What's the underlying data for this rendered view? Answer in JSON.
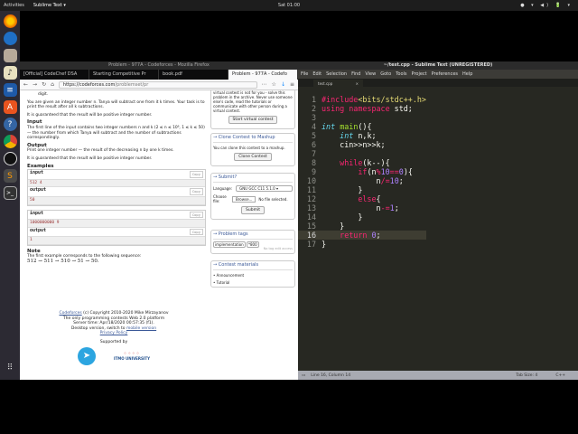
{
  "topbar": {
    "activities": "Activities",
    "app": "Sublime Text ▾",
    "clock": "Sat 01:00",
    "tray": "● ▾ ◀) 🔋 ▾"
  },
  "dock": {
    "items": [
      "firefox",
      "thunderbird",
      "files",
      "rhythmbox",
      "libreoffice-writer",
      "software-center",
      "help",
      "chrome",
      "obs",
      "sublime-text",
      "terminal"
    ],
    "apps_grid": "show-applications"
  },
  "firefox": {
    "title": "Problem - 977A - Codeforces - Mozilla Firefox",
    "tabs": [
      "[Official] CodeChef DSA",
      "Starting Competitive Pr",
      "book.pdf",
      "Problem - 977A - Codefo"
    ],
    "url_domain": "https://codeforces.com",
    "url_path": "/problemset/pr",
    "problem": {
      "prev_text": "digit.",
      "statement": "You are given an integer number n. Tanya will subtract one from it k times. Your task is to print the result after all k subtractions.",
      "guarantee": "It is guaranteed that the result will be positive integer number.",
      "input_title": "Input",
      "input_text": "The first line of the input contains two integer numbers n and k (2 ≤ n ≤ 10⁹, 1 ≤ k ≤ 50) — the number from which Tanya will subtract and the number of subtractions correspondingly.",
      "output_title": "Output",
      "output_text": "Print one integer number — the result of the decreasing n by one k times.",
      "guarantee2": "It is guaranteed that the result will be positive integer number.",
      "examples_title": "Examples",
      "input_label": "input",
      "output_label": "output",
      "copy": "Copy",
      "examples": [
        {
          "input": "512 4",
          "output": "50"
        },
        {
          "input": "1000000000 9",
          "output": "1"
        }
      ],
      "note_title": "Note",
      "note_text": "The first example corresponds to the following sequence:",
      "note_seq": "512 → 511 → 510 → 51 → 50."
    },
    "sidebar": {
      "virtual_text": "virtual contest is not for you - solve this problem in the archive. Never use someone else's code, read the tutorials or communicate with other person during a virtual contest.",
      "virtual_btn": "Start virtual contest",
      "clone_title": "→ Clone Contest to Mashup",
      "clone_text": "You can clone this contest to a mashup.",
      "clone_btn": "Clone Contest",
      "submit_title": "→ Submit?",
      "language_label": "Language:",
      "language_value": "GNU GCC C11 5.1.0",
      "file_label": "Choose file:",
      "browse": "Browse...",
      "no_file": "No file selected.",
      "submit_btn": "Submit",
      "tags_title": "→ Problem tags",
      "tags": [
        "implementation",
        "*800"
      ],
      "tags_note": "No tag edit access",
      "materials_title": "→ Contest materials",
      "materials": [
        "Announcement",
        "Tutorial"
      ]
    },
    "footer": {
      "link": "Codeforces",
      "copyright": "(c) Copyright 2010-2020 Mike Mirzayanov",
      "line2": "The only programming contests Web 2.0 platform",
      "line3": "Server time: Apr/18/2020 00:57:35 (f1).",
      "line4_pre": "Desktop version, switch to",
      "mobile": "mobile version",
      "privacy": "Privacy Policy",
      "supported": "Supported by",
      "itmo": "ITMO UNIVERSITY"
    }
  },
  "sublime": {
    "title": "~/test.cpp - Sublime Text (UNREGISTERED)",
    "menu": [
      "File",
      "Edit",
      "Selection",
      "Find",
      "View",
      "Goto",
      "Tools",
      "Project",
      "Preferences",
      "Help"
    ],
    "tab": "test.cpp",
    "status_left": "Line 16, Column 14",
    "status_tab": "Tab Size: 4",
    "status_lang": "C++"
  }
}
